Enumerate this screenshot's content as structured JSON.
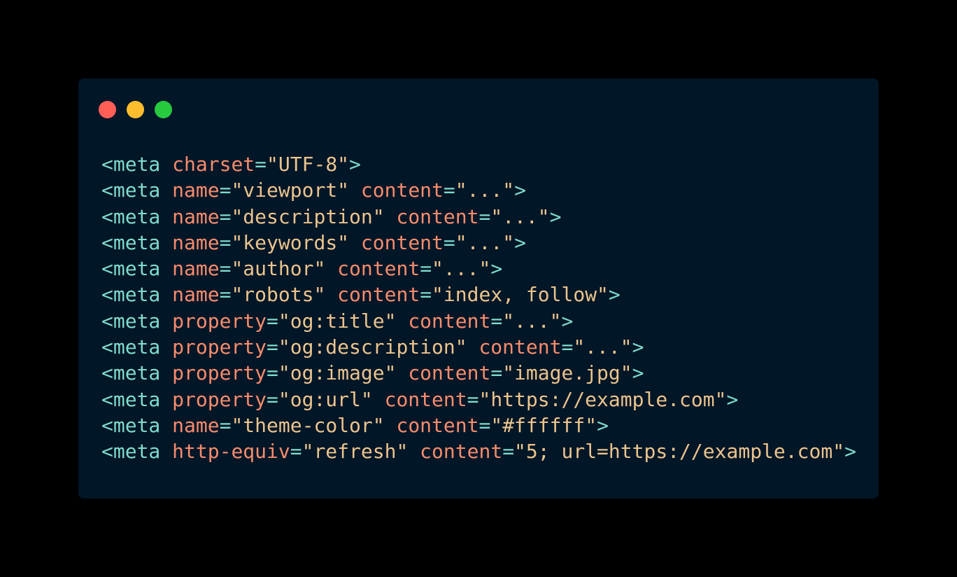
{
  "window": {
    "controls": [
      {
        "name": "close",
        "color": "#ff5f56"
      },
      {
        "name": "minimize",
        "color": "#ffbd2e"
      },
      {
        "name": "maximize",
        "color": "#27c93f"
      }
    ]
  },
  "theme": {
    "background": "#011627",
    "tag": "#7fdbca",
    "attribute": "#f78c6c",
    "string": "#ecc48d"
  },
  "code": {
    "language": "html",
    "lines": [
      {
        "tag": "<meta",
        "attrs": [
          {
            "name": "charset",
            "value": "\"UTF-8\""
          }
        ],
        "close": ">"
      },
      {
        "tag": "<meta",
        "attrs": [
          {
            "name": "name",
            "value": "\"viewport\""
          },
          {
            "name": "content",
            "value": "\"...\""
          }
        ],
        "close": ">"
      },
      {
        "tag": "<meta",
        "attrs": [
          {
            "name": "name",
            "value": "\"description\""
          },
          {
            "name": "content",
            "value": "\"...\""
          }
        ],
        "close": ">"
      },
      {
        "tag": "<meta",
        "attrs": [
          {
            "name": "name",
            "value": "\"keywords\""
          },
          {
            "name": "content",
            "value": "\"...\""
          }
        ],
        "close": ">"
      },
      {
        "tag": "<meta",
        "attrs": [
          {
            "name": "name",
            "value": "\"author\""
          },
          {
            "name": "content",
            "value": "\"...\""
          }
        ],
        "close": ">"
      },
      {
        "tag": "<meta",
        "attrs": [
          {
            "name": "name",
            "value": "\"robots\""
          },
          {
            "name": "content",
            "value": "\"index, follow\""
          }
        ],
        "close": ">"
      },
      {
        "tag": "<meta",
        "attrs": [
          {
            "name": "property",
            "value": "\"og:title\""
          },
          {
            "name": "content",
            "value": "\"...\""
          }
        ],
        "close": ">"
      },
      {
        "tag": "<meta",
        "attrs": [
          {
            "name": "property",
            "value": "\"og:description\""
          },
          {
            "name": "content",
            "value": "\"...\""
          }
        ],
        "close": ">"
      },
      {
        "tag": "<meta",
        "attrs": [
          {
            "name": "property",
            "value": "\"og:image\""
          },
          {
            "name": "content",
            "value": "\"image.jpg\""
          }
        ],
        "close": ">"
      },
      {
        "tag": "<meta",
        "attrs": [
          {
            "name": "property",
            "value": "\"og:url\""
          },
          {
            "name": "content",
            "value": "\"https://example.com\""
          }
        ],
        "close": ">"
      },
      {
        "tag": "<meta",
        "attrs": [
          {
            "name": "name",
            "value": "\"theme-color\""
          },
          {
            "name": "content",
            "value": "\"#ffffff\""
          }
        ],
        "close": ">"
      },
      {
        "tag": "<meta",
        "attrs": [
          {
            "name": "http-equiv",
            "value": "\"refresh\""
          },
          {
            "name": "content",
            "value": "\"5; url=https://example.com\""
          }
        ],
        "close": ">"
      }
    ]
  }
}
